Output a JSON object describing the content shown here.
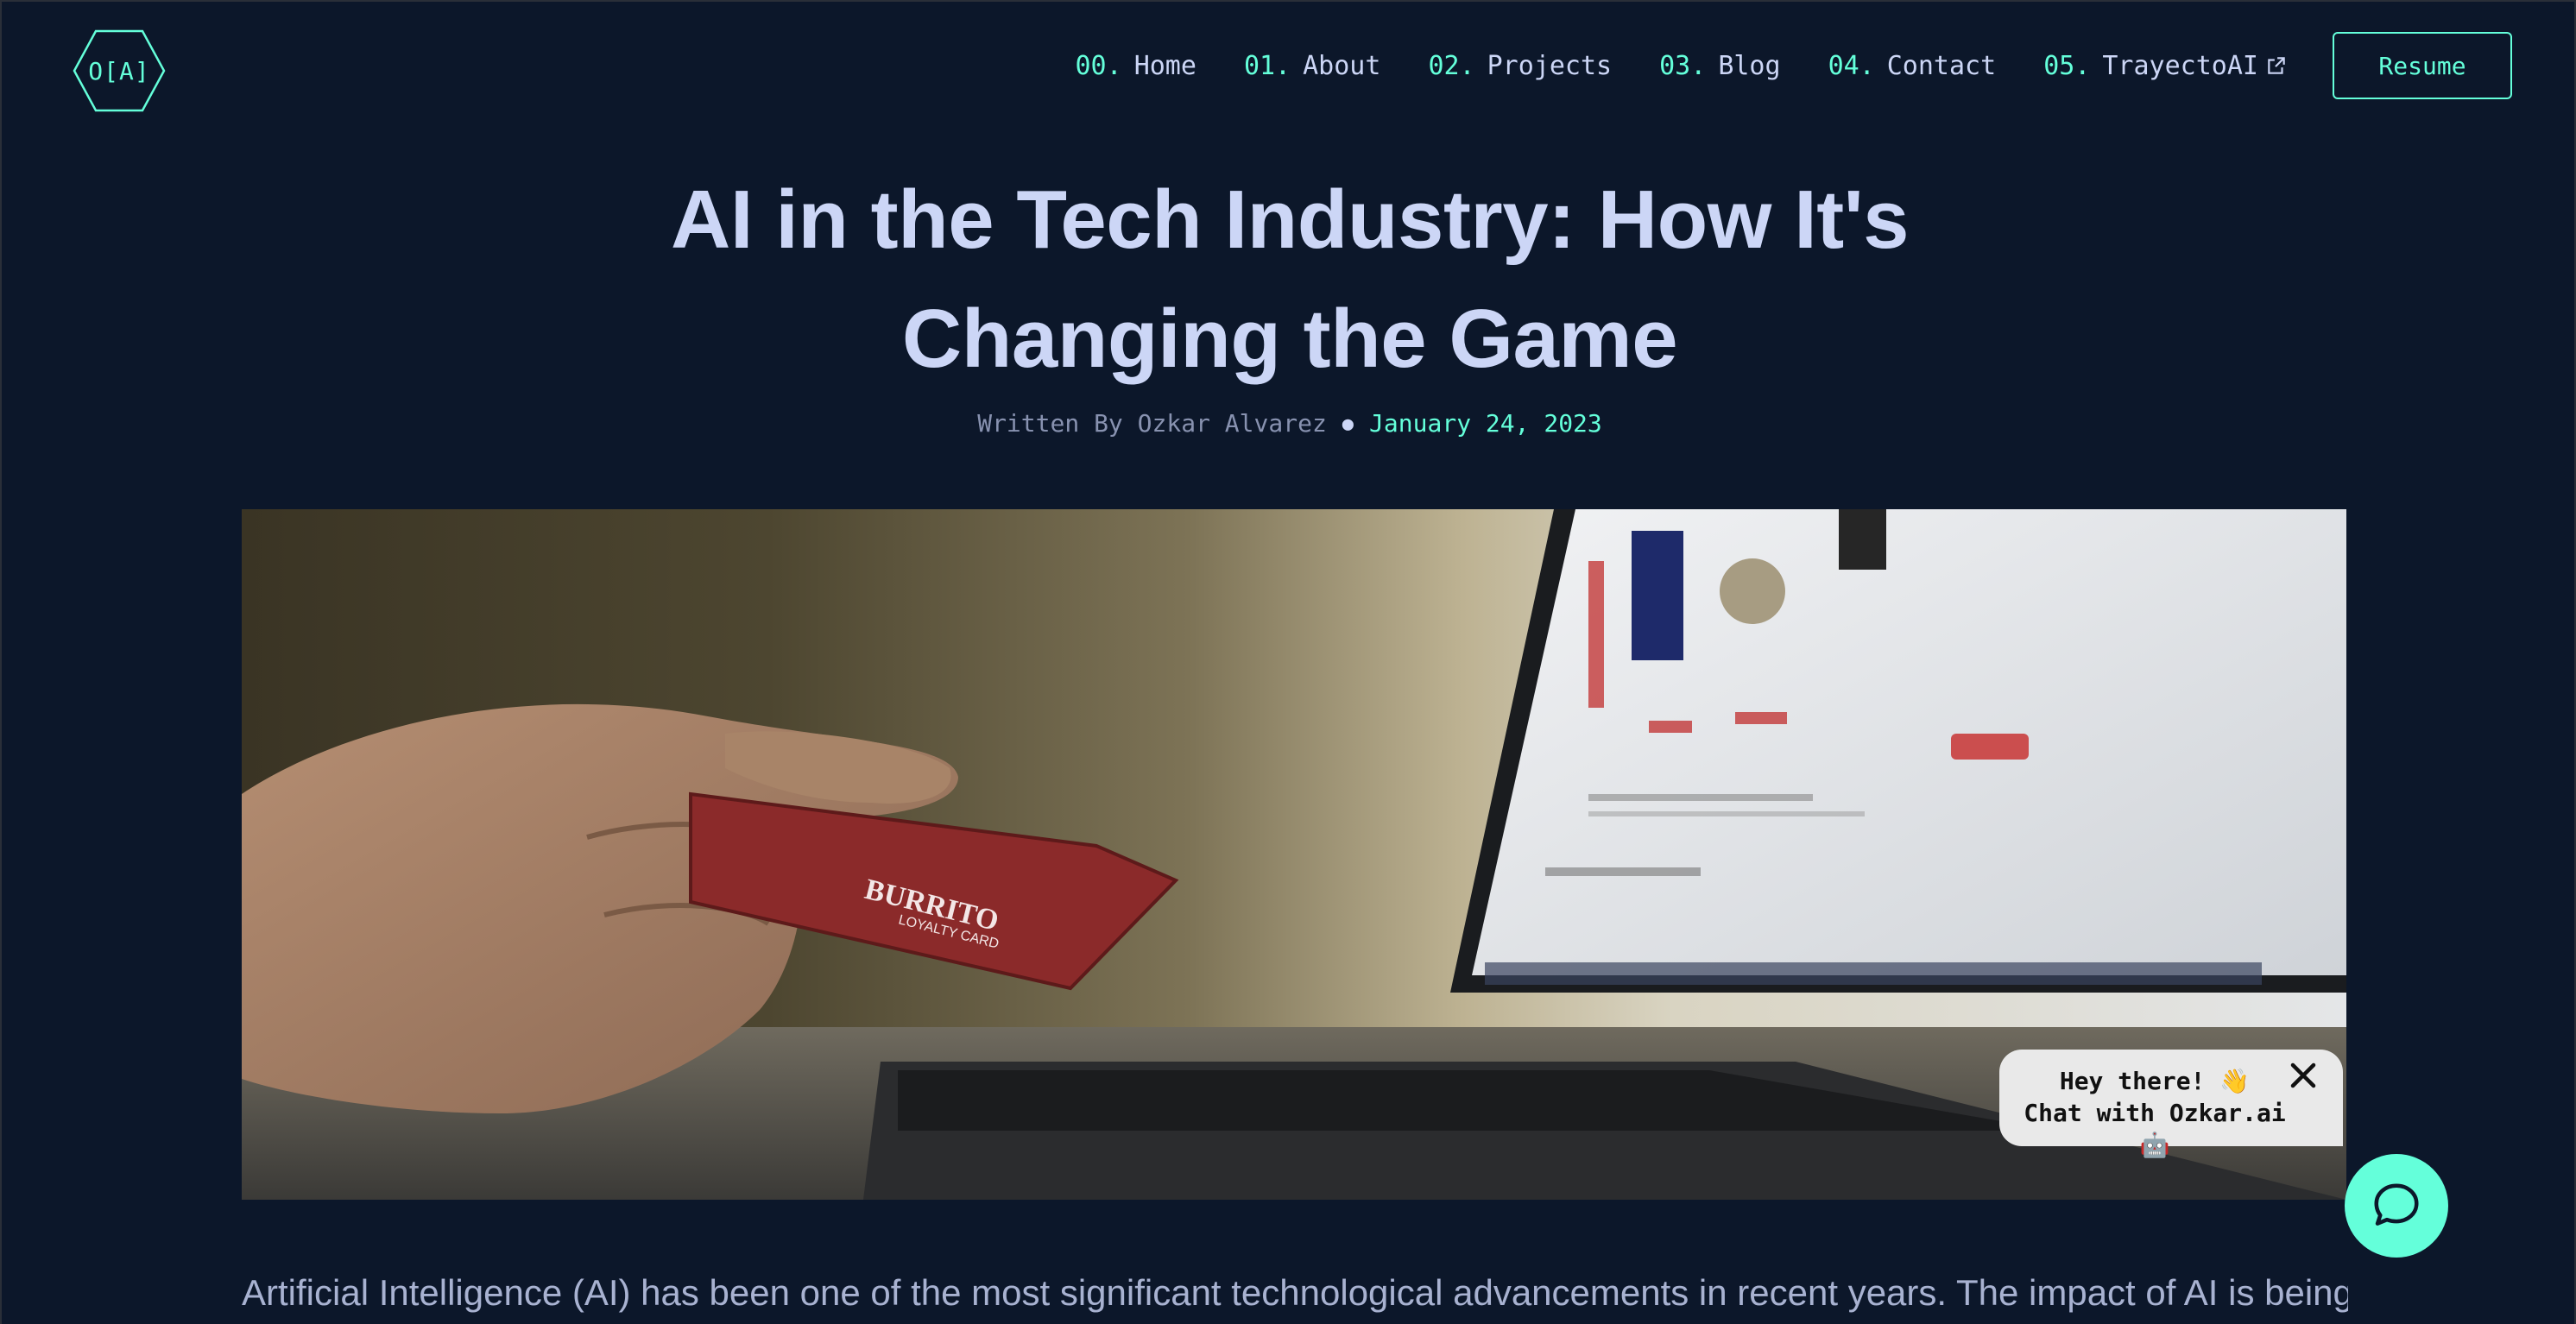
{
  "logo": {
    "text": "O[A]"
  },
  "nav": {
    "items": [
      {
        "num": "00.",
        "label": "Home"
      },
      {
        "num": "01.",
        "label": "About"
      },
      {
        "num": "02.",
        "label": "Projects"
      },
      {
        "num": "03.",
        "label": "Blog"
      },
      {
        "num": "04.",
        "label": "Contact"
      },
      {
        "num": "05.",
        "label": "TrayectoAI",
        "icon": "external-link-icon"
      }
    ],
    "resume_label": "Resume"
  },
  "article": {
    "title_line1": "AI in the Tech Industry: How It's",
    "title_line2": "Changing the Game",
    "byline_prefix": "Written By Ozkar Alvarez",
    "date": "January 24, 2023",
    "first_paragraph": "Artificial Intelligence (AI) has been one of the most significant technological advancements in recent years. The impact of AI is being felt"
  },
  "card_text": {
    "brand": "BURRITO",
    "sub": "LOYALTY CARD"
  },
  "chat": {
    "line1": "Hey there! 👋",
    "line2": "Chat with Ozkar.ai 🤖",
    "fab_icon": "chat-bubble-icon",
    "close_icon": "close-icon"
  },
  "colors": {
    "background": "#0c172a",
    "accent": "#64ffda",
    "heading": "#ccd6f6",
    "muted": "#8892b0"
  }
}
